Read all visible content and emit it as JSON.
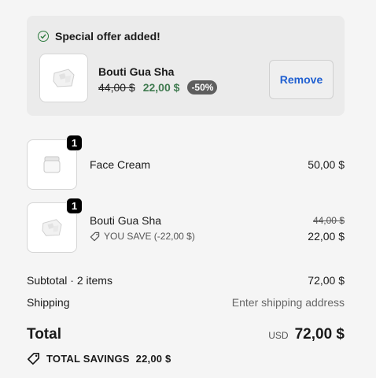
{
  "offer": {
    "heading": "Special offer added!",
    "product_name": "Bouti Gua Sha",
    "old_price": "44,00 $",
    "new_price": "22,00 $",
    "discount": "-50%",
    "remove_label": "Remove"
  },
  "items": [
    {
      "qty": "1",
      "name": "Face Cream",
      "price": "50,00 $"
    },
    {
      "qty": "1",
      "name": "Bouti Gua Sha",
      "old_price": "44,00 $",
      "price": "22,00 $",
      "save_text": "YOU SAVE (-22,00 $)"
    }
  ],
  "summary": {
    "subtotal_label": "Subtotal · 2 items",
    "subtotal_value": "72,00 $",
    "shipping_label": "Shipping",
    "shipping_value": "Enter shipping address",
    "total_label": "Total",
    "currency": "USD",
    "total_value": "72,00 $",
    "savings_label": "TOTAL SAVINGS",
    "savings_value": "22,00 $"
  },
  "colors": {
    "accent_green": "#3f7a4f",
    "remove_blue": "#1f5fd1",
    "badge_gray": "#5e5e5e"
  },
  "icons": {
    "offer_status": "check-circle-icon",
    "savings": "tag-icon",
    "product_gua_sha": "gua-sha-product-image",
    "product_face_cream": "face-cream-product-image"
  }
}
